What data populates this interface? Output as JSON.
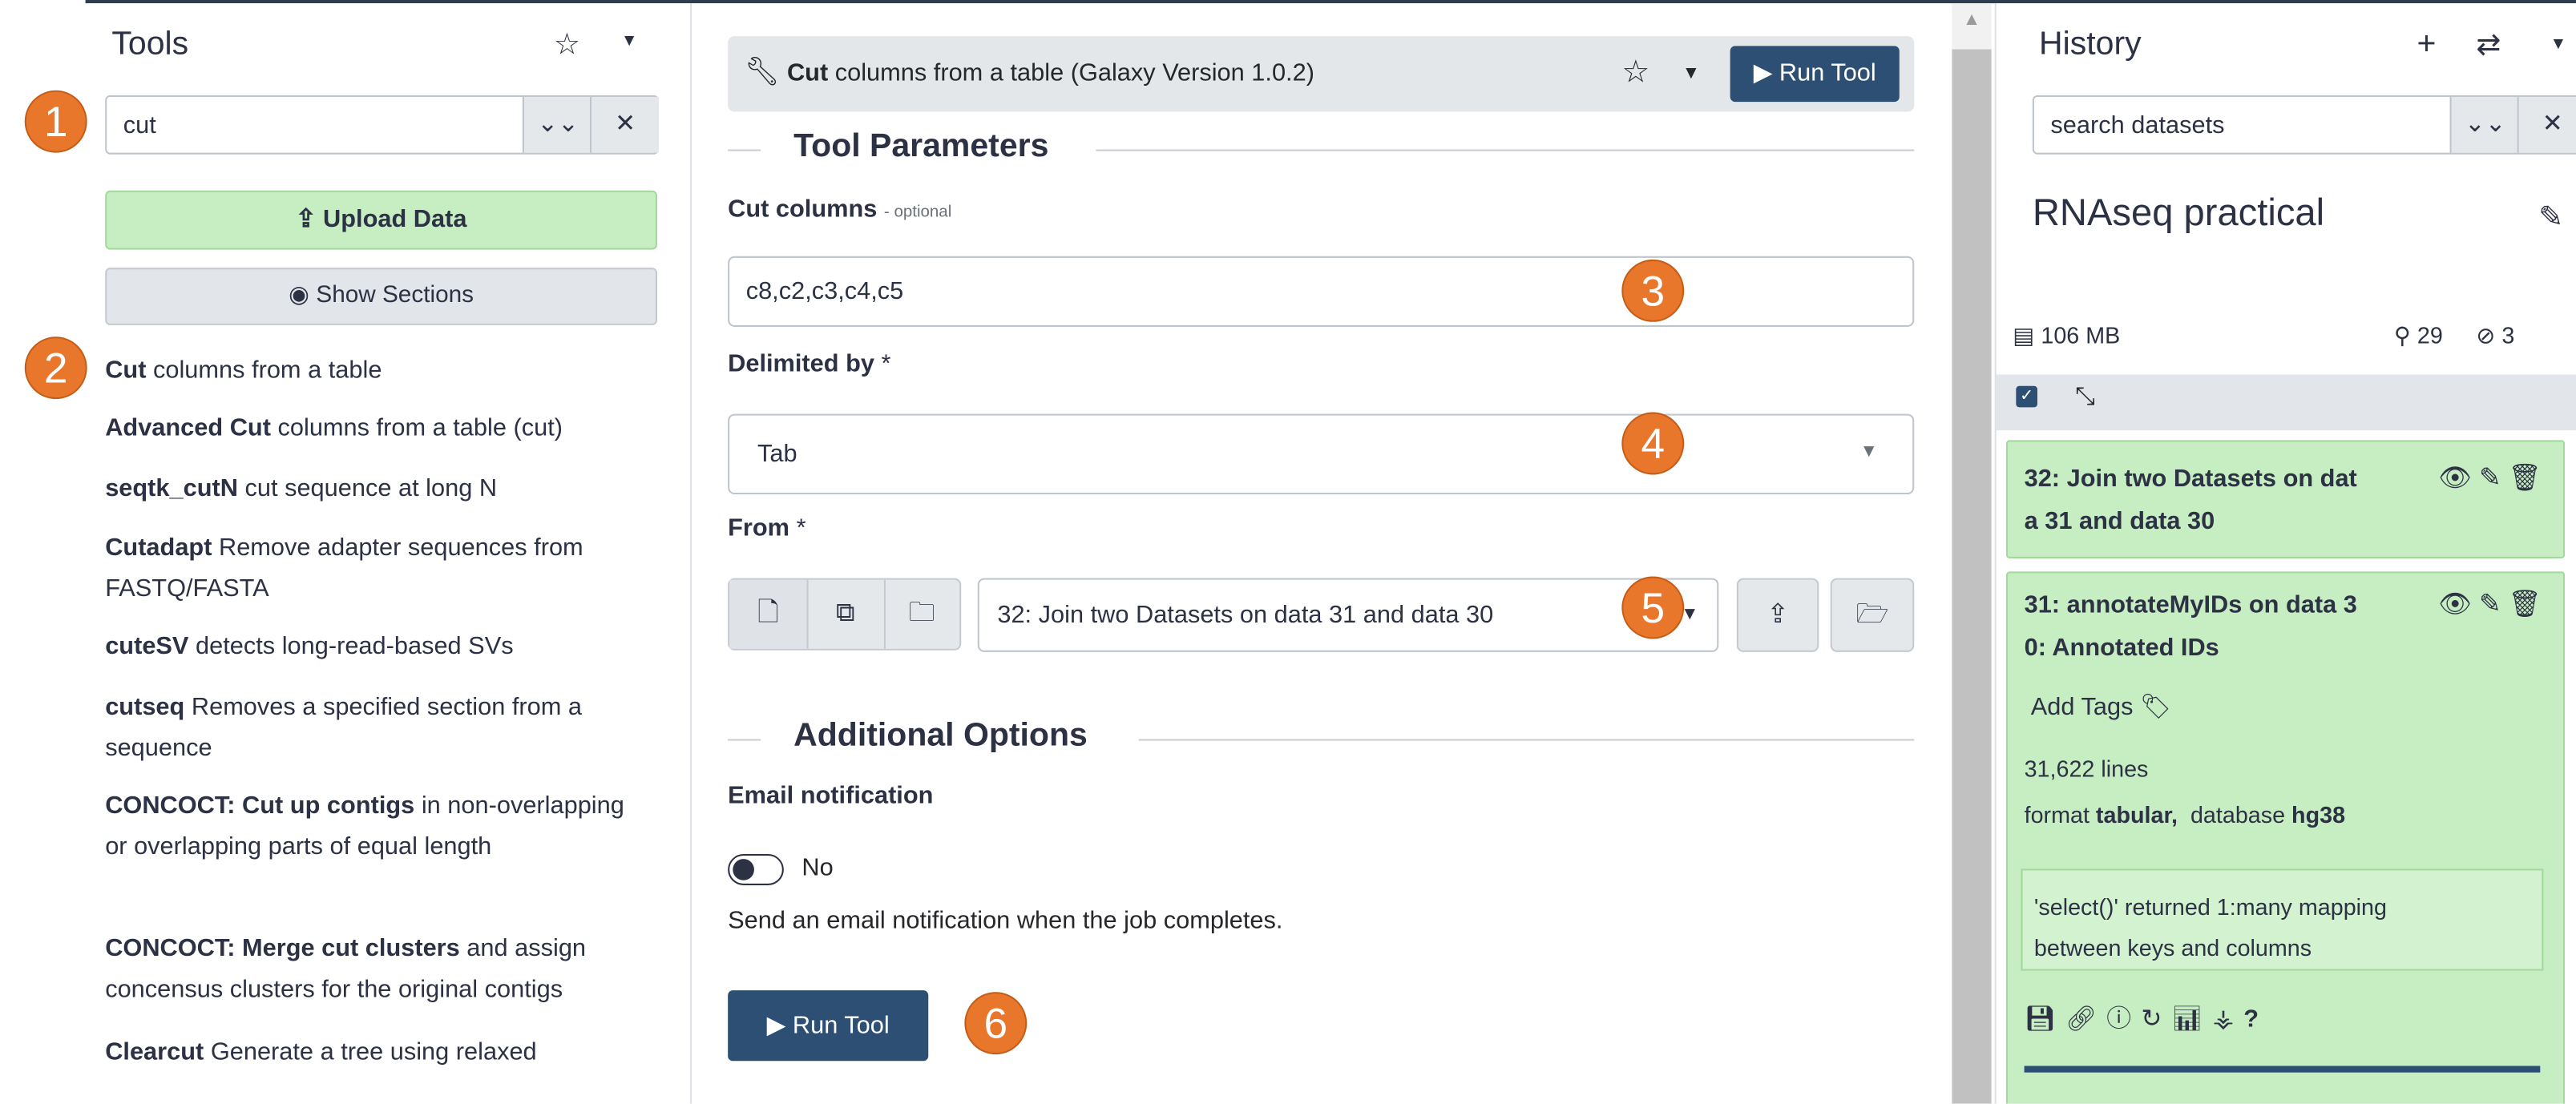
{
  "tools_panel": {
    "heading": "Tools",
    "search_value": "cut",
    "upload_label": "Upload Data",
    "show_sections_label": "Show Sections",
    "items": [
      {
        "name": "Cut",
        "desc": "columns from a table"
      },
      {
        "name": "Advanced Cut",
        "desc": "columns from a table (cut)"
      },
      {
        "name": "seqtk_cutN",
        "desc": "cut sequence at long N"
      },
      {
        "name": "Cutadapt",
        "desc": "Remove adapter sequences from FASTQ/FASTA"
      },
      {
        "name": "cuteSV",
        "desc": "detects long-read-based SVs"
      },
      {
        "name": "cutseq",
        "desc": "Removes a specified section from a sequence"
      },
      {
        "name": "CONCOCT: Cut up contigs",
        "desc": "in non-overlapping or overlapping parts of equal length"
      },
      {
        "name": "CONCOCT: Merge cut clusters",
        "desc": "and assign concensus clusters for the original contigs"
      },
      {
        "name": "Clearcut",
        "desc": "Generate a tree using relaxed"
      }
    ]
  },
  "tool_form": {
    "tool_name": "Cut",
    "tool_desc": "columns from a table (Galaxy Version 1.0.2)",
    "run_label": "Run Tool",
    "params_title": "Tool Parameters",
    "cut_columns_label": "Cut columns",
    "cut_columns_optional": "- optional",
    "cut_columns_value": "c8,c2,c3,c4,c5",
    "delimited_label": "Delimited by",
    "delimited_value": "Tab",
    "from_label": "From",
    "from_value": "32: Join two Datasets on data 31 and data 30",
    "required_mark": "*",
    "additional_title": "Additional Options",
    "email_label": "Email notification",
    "email_toggle_value": "No",
    "email_help": "Send an email notification when the job completes.",
    "run_bottom_label": "Run Tool"
  },
  "markers": [
    "1",
    "2",
    "3",
    "4",
    "5",
    "6"
  ],
  "history": {
    "heading": "History",
    "search_placeholder": "search datasets",
    "name": "RNAseq practical",
    "size": "106 MB",
    "count_shown": "29",
    "count_hidden": "3",
    "items": [
      {
        "title_line1": "32: Join two Datasets on dat",
        "title_line2": "a 31 and data 30"
      },
      {
        "title_line1": "31: annotateMyIDs on data 3",
        "title_line2": "0: Annotated IDs"
      }
    ],
    "add_tags": "Add Tags",
    "lines": "31,622 lines",
    "format_label": "format",
    "format_value": "tabular,",
    "database_label": "database",
    "database_value": "hg38",
    "info_text_1": "'select()' returned 1:many mapping",
    "info_text_2": "between keys and columns",
    "help_icon_text": "?"
  },
  "colors": {
    "primary": "#2c4f73",
    "success_bg": "#c7eec3",
    "marker": "#e8762b"
  }
}
